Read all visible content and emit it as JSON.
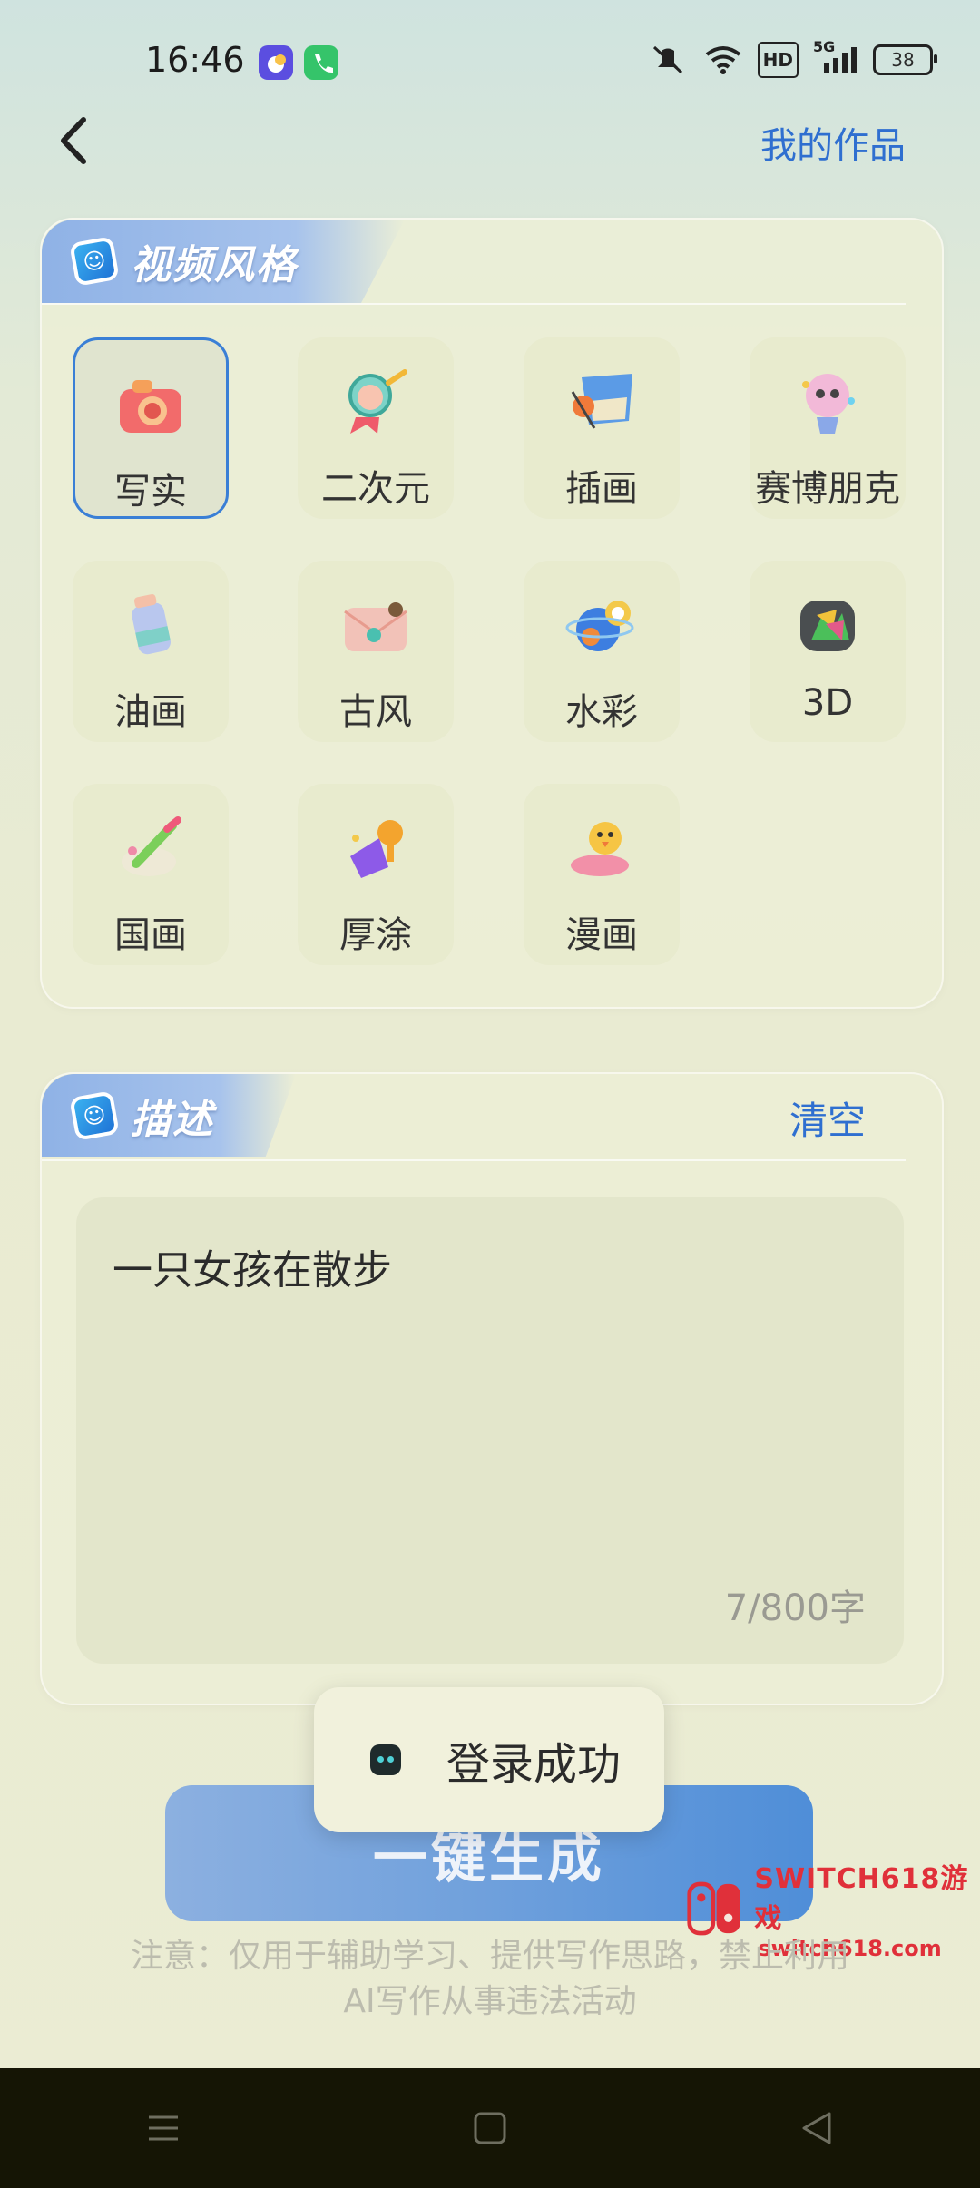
{
  "status_bar": {
    "time": "16:46",
    "network": "5G",
    "hd": "HD",
    "battery": "38"
  },
  "header": {
    "my_works": "我的作品"
  },
  "style_section": {
    "title": "视频风格",
    "items": [
      {
        "label": "写实",
        "icon": "camera-icon",
        "selected": true
      },
      {
        "label": "二次元",
        "icon": "anime-magnifier-icon",
        "selected": false
      },
      {
        "label": "插画",
        "icon": "illustration-frame-icon",
        "selected": false
      },
      {
        "label": "赛博朋克",
        "icon": "cyberpunk-bulb-icon",
        "selected": false
      },
      {
        "label": "油画",
        "icon": "oil-paint-tube-icon",
        "selected": false
      },
      {
        "label": "古风",
        "icon": "ancient-envelope-icon",
        "selected": false
      },
      {
        "label": "水彩",
        "icon": "watercolor-planet-icon",
        "selected": false
      },
      {
        "label": "3D",
        "icon": "3d-block-icon",
        "selected": false
      },
      {
        "label": "国画",
        "icon": "brush-palette-icon",
        "selected": false
      },
      {
        "label": "厚涂",
        "icon": "thick-paint-icon",
        "selected": false
      },
      {
        "label": "漫画",
        "icon": "comic-duck-icon",
        "selected": false
      }
    ]
  },
  "description_section": {
    "title": "描述",
    "clear_label": "清空",
    "text": "一只女孩在散步",
    "char_count": "7/800字"
  },
  "generate_button": {
    "label": "一键生成"
  },
  "toast": {
    "text": "登录成功"
  },
  "notice": {
    "line1": "注意：仅用于辅助学习、提供写作思路，禁止利用",
    "line2": "AI写作从事违法活动"
  },
  "watermark": {
    "title": "SWITCH618游戏",
    "url": "switch618.com"
  },
  "colors": {
    "accent": "#2f6fd0",
    "button": "#6fa0dc",
    "watermark": "#e0303a"
  }
}
